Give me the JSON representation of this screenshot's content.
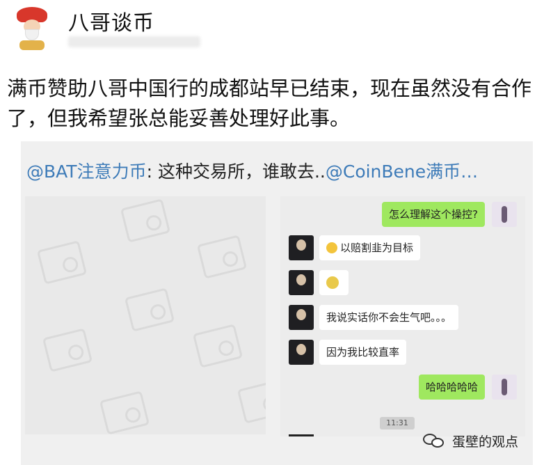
{
  "post": {
    "author": "八哥谈币",
    "text": "满币赞助八哥中国行的成都站早已结束，现在虽然没有合作了，但我希望张总能妥善处理好此事。"
  },
  "repost": {
    "mention1": "@BAT注意力币",
    "middle": ": 这种交易所，谁敢去..",
    "mention2": "@CoinBene满币…"
  },
  "chat": {
    "messages": [
      {
        "side": "out",
        "text": "怎么理解这个操控?"
      },
      {
        "side": "in",
        "emoji": "smile-emoji",
        "text": "以赔割韭为目标"
      },
      {
        "side": "in",
        "emoji": "emoji-sticker",
        "text": ""
      },
      {
        "side": "in",
        "emoji": "",
        "text": "我说实话你不会生气吧。。。"
      },
      {
        "side": "in",
        "emoji": "",
        "text": "因为我比较直率"
      },
      {
        "side": "out",
        "text": "哈哈哈哈哈"
      }
    ],
    "timestamp": "11:31"
  },
  "watermark": {
    "icon": "wechat-icon",
    "text": "蛋壁的观点"
  }
}
